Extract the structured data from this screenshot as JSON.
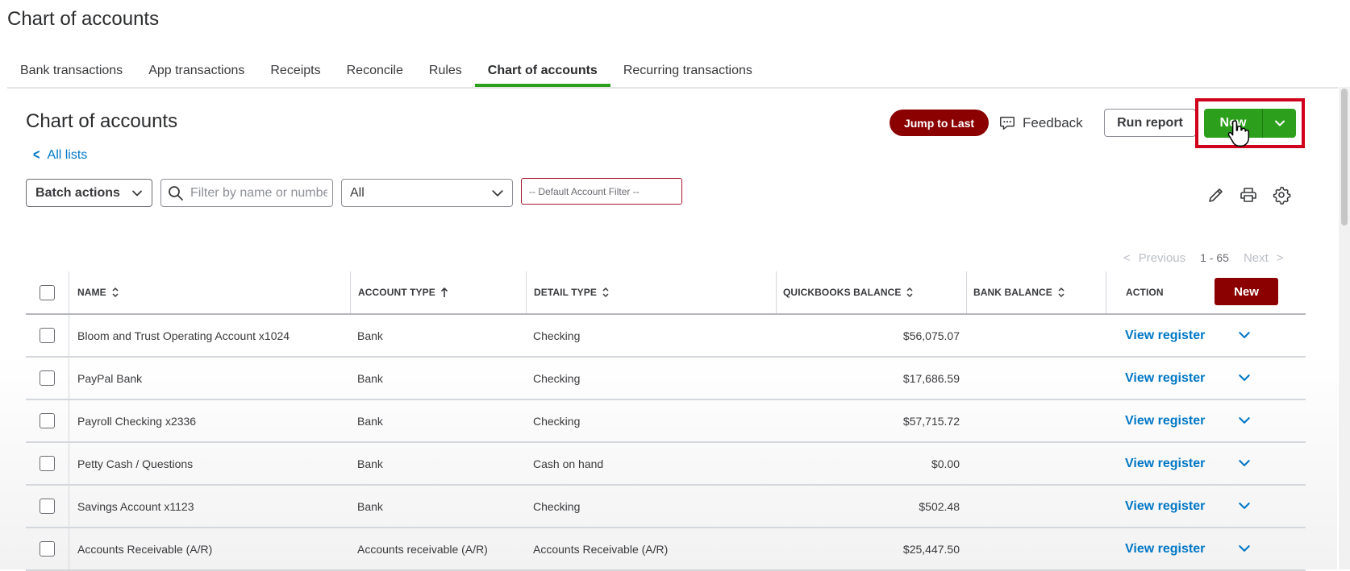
{
  "page": {
    "title": "Chart of accounts"
  },
  "tabs": [
    {
      "label": "Bank transactions",
      "active": false
    },
    {
      "label": "App transactions",
      "active": false
    },
    {
      "label": "Receipts",
      "active": false
    },
    {
      "label": "Reconcile",
      "active": false
    },
    {
      "label": "Rules",
      "active": false
    },
    {
      "label": "Chart of accounts",
      "active": true
    },
    {
      "label": "Recurring transactions",
      "active": false
    }
  ],
  "header": {
    "title": "Chart of accounts",
    "back_link": "All lists",
    "jump_to_last": "Jump to Last",
    "feedback": "Feedback",
    "run_report": "Run report",
    "new_label": "New"
  },
  "toolbar": {
    "batch_actions": "Batch actions",
    "search_placeholder": "Filter by name or number",
    "type_filter": "All",
    "default_filter": "-- Default Account Filter --"
  },
  "pagination": {
    "previous": "Previous",
    "range": "1 - 65",
    "next": "Next"
  },
  "table": {
    "columns": {
      "name": "NAME",
      "account_type": "ACCOUNT TYPE",
      "detail_type": "DETAIL TYPE",
      "qb_balance": "QUICKBOOKS BALANCE",
      "bank_balance": "BANK BALANCE",
      "action": "ACTION"
    },
    "new_button": "New",
    "action_label": "View register",
    "rows": [
      {
        "name": "Bloom and Trust Operating Account x1024",
        "type": "Bank",
        "detail": "Checking",
        "qb_balance": "$56,075.07",
        "bank_balance": ""
      },
      {
        "name": "PayPal Bank",
        "type": "Bank",
        "detail": "Checking",
        "qb_balance": "$17,686.59",
        "bank_balance": ""
      },
      {
        "name": "Payroll Checking x2336",
        "type": "Bank",
        "detail": "Checking",
        "qb_balance": "$57,715.72",
        "bank_balance": ""
      },
      {
        "name": "Petty Cash / Questions",
        "type": "Bank",
        "detail": "Cash on hand",
        "qb_balance": "$0.00",
        "bank_balance": ""
      },
      {
        "name": "Savings Account x1123",
        "type": "Bank",
        "detail": "Checking",
        "qb_balance": "$502.48",
        "bank_balance": ""
      },
      {
        "name": "Accounts Receivable (A/R)",
        "type": "Accounts receivable (A/R)",
        "detail": "Accounts Receivable (A/R)",
        "qb_balance": "$25,447.50",
        "bank_balance": ""
      }
    ]
  },
  "icons": {
    "edit": "pencil-icon",
    "print": "printer-icon",
    "settings": "gear-icon",
    "search": "search-icon",
    "feedback": "feedback-icon"
  },
  "colors": {
    "brand_green": "#2ca01c",
    "dark_red": "#8b0000",
    "link_blue": "#0077c5",
    "highlight_red": "#d0021b"
  }
}
